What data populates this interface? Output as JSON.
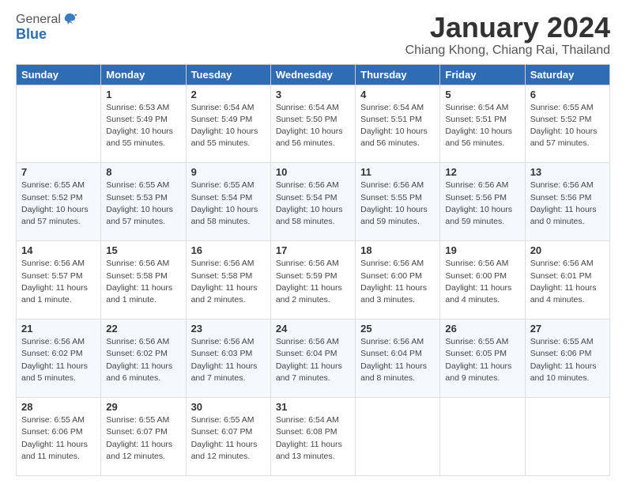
{
  "logo": {
    "general": "General",
    "blue": "Blue"
  },
  "header": {
    "month_title": "January 2024",
    "location": "Chiang Khong, Chiang Rai, Thailand"
  },
  "weekdays": [
    "Sunday",
    "Monday",
    "Tuesday",
    "Wednesday",
    "Thursday",
    "Friday",
    "Saturday"
  ],
  "weeks": [
    [
      {
        "day": "",
        "info": ""
      },
      {
        "day": "1",
        "info": "Sunrise: 6:53 AM\nSunset: 5:49 PM\nDaylight: 10 hours\nand 55 minutes."
      },
      {
        "day": "2",
        "info": "Sunrise: 6:54 AM\nSunset: 5:49 PM\nDaylight: 10 hours\nand 55 minutes."
      },
      {
        "day": "3",
        "info": "Sunrise: 6:54 AM\nSunset: 5:50 PM\nDaylight: 10 hours\nand 56 minutes."
      },
      {
        "day": "4",
        "info": "Sunrise: 6:54 AM\nSunset: 5:51 PM\nDaylight: 10 hours\nand 56 minutes."
      },
      {
        "day": "5",
        "info": "Sunrise: 6:54 AM\nSunset: 5:51 PM\nDaylight: 10 hours\nand 56 minutes."
      },
      {
        "day": "6",
        "info": "Sunrise: 6:55 AM\nSunset: 5:52 PM\nDaylight: 10 hours\nand 57 minutes."
      }
    ],
    [
      {
        "day": "7",
        "info": "Sunrise: 6:55 AM\nSunset: 5:52 PM\nDaylight: 10 hours\nand 57 minutes."
      },
      {
        "day": "8",
        "info": "Sunrise: 6:55 AM\nSunset: 5:53 PM\nDaylight: 10 hours\nand 57 minutes."
      },
      {
        "day": "9",
        "info": "Sunrise: 6:55 AM\nSunset: 5:54 PM\nDaylight: 10 hours\nand 58 minutes."
      },
      {
        "day": "10",
        "info": "Sunrise: 6:56 AM\nSunset: 5:54 PM\nDaylight: 10 hours\nand 58 minutes."
      },
      {
        "day": "11",
        "info": "Sunrise: 6:56 AM\nSunset: 5:55 PM\nDaylight: 10 hours\nand 59 minutes."
      },
      {
        "day": "12",
        "info": "Sunrise: 6:56 AM\nSunset: 5:56 PM\nDaylight: 10 hours\nand 59 minutes."
      },
      {
        "day": "13",
        "info": "Sunrise: 6:56 AM\nSunset: 5:56 PM\nDaylight: 11 hours\nand 0 minutes."
      }
    ],
    [
      {
        "day": "14",
        "info": "Sunrise: 6:56 AM\nSunset: 5:57 PM\nDaylight: 11 hours\nand 1 minute."
      },
      {
        "day": "15",
        "info": "Sunrise: 6:56 AM\nSunset: 5:58 PM\nDaylight: 11 hours\nand 1 minute."
      },
      {
        "day": "16",
        "info": "Sunrise: 6:56 AM\nSunset: 5:58 PM\nDaylight: 11 hours\nand 2 minutes."
      },
      {
        "day": "17",
        "info": "Sunrise: 6:56 AM\nSunset: 5:59 PM\nDaylight: 11 hours\nand 2 minutes."
      },
      {
        "day": "18",
        "info": "Sunrise: 6:56 AM\nSunset: 6:00 PM\nDaylight: 11 hours\nand 3 minutes."
      },
      {
        "day": "19",
        "info": "Sunrise: 6:56 AM\nSunset: 6:00 PM\nDaylight: 11 hours\nand 4 minutes."
      },
      {
        "day": "20",
        "info": "Sunrise: 6:56 AM\nSunset: 6:01 PM\nDaylight: 11 hours\nand 4 minutes."
      }
    ],
    [
      {
        "day": "21",
        "info": "Sunrise: 6:56 AM\nSunset: 6:02 PM\nDaylight: 11 hours\nand 5 minutes."
      },
      {
        "day": "22",
        "info": "Sunrise: 6:56 AM\nSunset: 6:02 PM\nDaylight: 11 hours\nand 6 minutes."
      },
      {
        "day": "23",
        "info": "Sunrise: 6:56 AM\nSunset: 6:03 PM\nDaylight: 11 hours\nand 7 minutes."
      },
      {
        "day": "24",
        "info": "Sunrise: 6:56 AM\nSunset: 6:04 PM\nDaylight: 11 hours\nand 7 minutes."
      },
      {
        "day": "25",
        "info": "Sunrise: 6:56 AM\nSunset: 6:04 PM\nDaylight: 11 hours\nand 8 minutes."
      },
      {
        "day": "26",
        "info": "Sunrise: 6:55 AM\nSunset: 6:05 PM\nDaylight: 11 hours\nand 9 minutes."
      },
      {
        "day": "27",
        "info": "Sunrise: 6:55 AM\nSunset: 6:06 PM\nDaylight: 11 hours\nand 10 minutes."
      }
    ],
    [
      {
        "day": "28",
        "info": "Sunrise: 6:55 AM\nSunset: 6:06 PM\nDaylight: 11 hours\nand 11 minutes."
      },
      {
        "day": "29",
        "info": "Sunrise: 6:55 AM\nSunset: 6:07 PM\nDaylight: 11 hours\nand 12 minutes."
      },
      {
        "day": "30",
        "info": "Sunrise: 6:55 AM\nSunset: 6:07 PM\nDaylight: 11 hours\nand 12 minutes."
      },
      {
        "day": "31",
        "info": "Sunrise: 6:54 AM\nSunset: 6:08 PM\nDaylight: 11 hours\nand 13 minutes."
      },
      {
        "day": "",
        "info": ""
      },
      {
        "day": "",
        "info": ""
      },
      {
        "day": "",
        "info": ""
      }
    ]
  ]
}
